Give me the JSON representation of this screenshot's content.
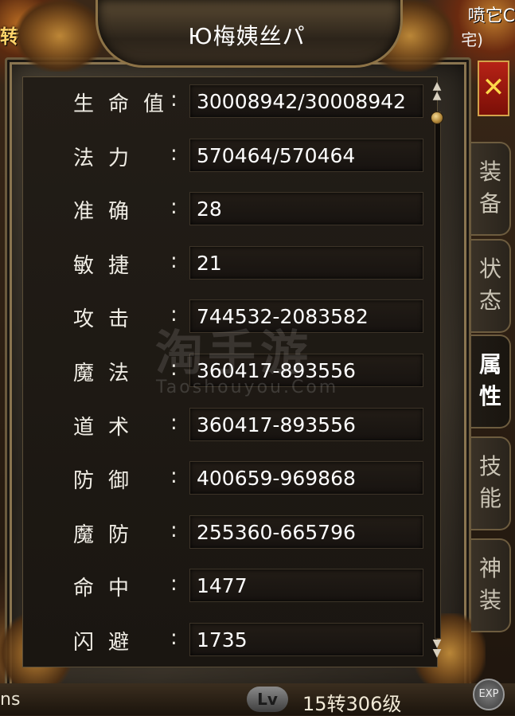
{
  "header": {
    "top_left_text": "转",
    "top_right_text": "喷它C",
    "top_right_text2": "宅)",
    "title": "Ю梅姨丝パ"
  },
  "close_button": {
    "label": "✕"
  },
  "stats": [
    {
      "c1": "生",
      "c2": "命",
      "c3": "值",
      "value": "30008942/30008942"
    },
    {
      "c1": "法",
      "c2": "",
      "c3": "力",
      "value": "570464/570464"
    },
    {
      "c1": "准",
      "c2": "",
      "c3": "确",
      "value": "28"
    },
    {
      "c1": "敏",
      "c2": "",
      "c3": "捷",
      "value": "21"
    },
    {
      "c1": "攻",
      "c2": "",
      "c3": "击",
      "value": "744532-2083582"
    },
    {
      "c1": "魔",
      "c2": "",
      "c3": "法",
      "value": "360417-893556"
    },
    {
      "c1": "道",
      "c2": "",
      "c3": "术",
      "value": "360417-893556"
    },
    {
      "c1": "防",
      "c2": "",
      "c3": "御",
      "value": "400659-969868"
    },
    {
      "c1": "魔",
      "c2": "",
      "c3": "防",
      "value": "255360-665796"
    },
    {
      "c1": "命",
      "c2": "",
      "c3": "中",
      "value": "1477"
    },
    {
      "c1": "闪",
      "c2": "",
      "c3": "避",
      "value": "1735"
    }
  ],
  "colon": ":",
  "side_tabs": [
    {
      "label_top": "装",
      "label_bottom": "备",
      "active": false
    },
    {
      "label_top": "状",
      "label_bottom": "态",
      "active": false
    },
    {
      "label_top": "属",
      "label_bottom": "性",
      "active": true
    },
    {
      "label_top": "技",
      "label_bottom": "能",
      "active": false
    },
    {
      "label_top": "神",
      "label_bottom": "装",
      "active": false
    }
  ],
  "bottom": {
    "left_text": "ns",
    "lv_label": "Lv",
    "level_text": "15转306级",
    "exp_label": "EXP"
  },
  "watermark": {
    "main": "淘手游",
    "sub": "Taoshouyou.Com"
  },
  "colors": {
    "text": "#ffffff",
    "label": "#f0ede5",
    "close_bg": "#b62216",
    "frame": "#8a7550"
  },
  "icons": {
    "close": "close-icon",
    "scroll_up": "scroll-up-icon",
    "scroll_down": "scroll-down-icon"
  }
}
